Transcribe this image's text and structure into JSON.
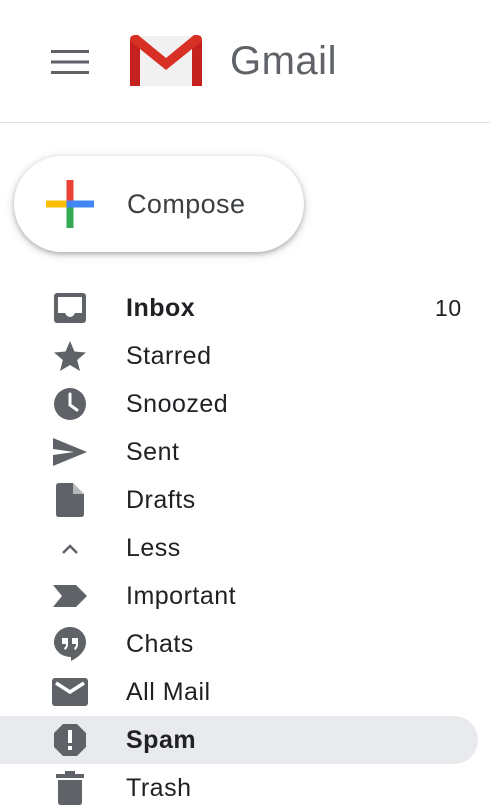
{
  "header": {
    "menu_icon": "hamburger-menu-icon",
    "logo_icon": "gmail-logo-icon",
    "brand": "Gmail"
  },
  "compose": {
    "label": "Compose",
    "icon": "plus-icon"
  },
  "colors": {
    "logo_red": "#d93025",
    "plus_blue": "#4285f4",
    "plus_red": "#ea4335",
    "plus_yellow": "#fbbc04",
    "plus_green": "#34a853",
    "icon_gray": "#5f6368",
    "active_bg": "#e8eaed"
  },
  "nav": {
    "items": [
      {
        "label": "Inbox",
        "icon": "inbox-icon",
        "count": "10",
        "bold": true
      },
      {
        "label": "Starred",
        "icon": "star-icon"
      },
      {
        "label": "Snoozed",
        "icon": "clock-icon"
      },
      {
        "label": "Sent",
        "icon": "send-icon"
      },
      {
        "label": "Drafts",
        "icon": "draft-icon"
      },
      {
        "label": "Less",
        "icon": "chevron-up-icon"
      },
      {
        "label": "Important",
        "icon": "important-icon"
      },
      {
        "label": "Chats",
        "icon": "chat-icon"
      },
      {
        "label": "All Mail",
        "icon": "mail-icon"
      },
      {
        "label": "Spam",
        "icon": "spam-icon",
        "active": true,
        "bold": true
      },
      {
        "label": "Trash",
        "icon": "trash-icon"
      }
    ]
  }
}
